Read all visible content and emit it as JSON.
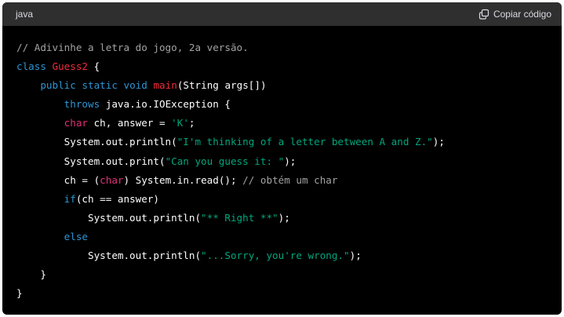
{
  "header": {
    "language": "java",
    "copy_label": "Copiar código",
    "copy_icon": "copy-icon"
  },
  "colors": {
    "background": "#000000",
    "header_bg": "#2f2f2f",
    "comment": "#a3a3a3",
    "keyword": "#2e95d3",
    "title": "#f22c3d",
    "type": "#df3079",
    "string": "#00a67d"
  },
  "code": {
    "lines": [
      [
        {
          "t": "comment",
          "s": "// Adivinhe a letra do jogo, 2a versão."
        }
      ],
      [
        {
          "t": "keyword",
          "s": "class"
        },
        {
          "t": "plain",
          "s": " "
        },
        {
          "t": "title",
          "s": "Guess2"
        },
        {
          "t": "plain",
          "s": " {"
        }
      ],
      [
        {
          "t": "plain",
          "s": "    "
        },
        {
          "t": "keyword",
          "s": "public"
        },
        {
          "t": "plain",
          "s": " "
        },
        {
          "t": "keyword",
          "s": "static"
        },
        {
          "t": "plain",
          "s": " "
        },
        {
          "t": "keyword",
          "s": "void"
        },
        {
          "t": "plain",
          "s": " "
        },
        {
          "t": "title",
          "s": "main"
        },
        {
          "t": "plain",
          "s": "(String args[])"
        }
      ],
      [
        {
          "t": "plain",
          "s": "        "
        },
        {
          "t": "keyword",
          "s": "throws"
        },
        {
          "t": "plain",
          "s": " java.io.IOException {"
        }
      ],
      [
        {
          "t": "plain",
          "s": "        "
        },
        {
          "t": "type",
          "s": "char"
        },
        {
          "t": "plain",
          "s": " ch, answer = "
        },
        {
          "t": "string",
          "s": "'K'"
        },
        {
          "t": "plain",
          "s": ";"
        }
      ],
      [
        {
          "t": "plain",
          "s": "        System.out.println("
        },
        {
          "t": "string",
          "s": "\"I'm thinking of a letter between A and Z.\""
        },
        {
          "t": "plain",
          "s": ");"
        }
      ],
      [
        {
          "t": "plain",
          "s": "        System.out.print("
        },
        {
          "t": "string",
          "s": "\"Can you guess it: \""
        },
        {
          "t": "plain",
          "s": ");"
        }
      ],
      [
        {
          "t": "plain",
          "s": "        ch = ("
        },
        {
          "t": "type",
          "s": "char"
        },
        {
          "t": "plain",
          "s": ") System.in.read(); "
        },
        {
          "t": "comment",
          "s": "// obtém um char"
        }
      ],
      [
        {
          "t": "plain",
          "s": "        "
        },
        {
          "t": "keyword",
          "s": "if"
        },
        {
          "t": "plain",
          "s": "(ch == answer)"
        }
      ],
      [
        {
          "t": "plain",
          "s": "            System.out.println("
        },
        {
          "t": "string",
          "s": "\"** Right **\""
        },
        {
          "t": "plain",
          "s": ");"
        }
      ],
      [
        {
          "t": "plain",
          "s": "        "
        },
        {
          "t": "keyword",
          "s": "else"
        }
      ],
      [
        {
          "t": "plain",
          "s": "            System.out.println("
        },
        {
          "t": "string",
          "s": "\"...Sorry, you're wrong.\""
        },
        {
          "t": "plain",
          "s": ");"
        }
      ],
      [
        {
          "t": "plain",
          "s": "    }"
        }
      ],
      [
        {
          "t": "plain",
          "s": "}"
        }
      ]
    ]
  }
}
